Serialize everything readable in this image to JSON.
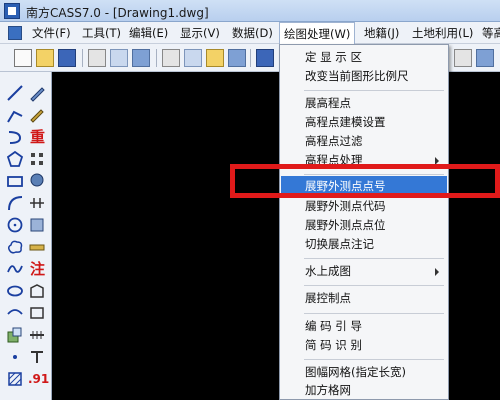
{
  "window": {
    "title": "南方CASS7.0 - [Drawing1.dwg]"
  },
  "menubar": {
    "items": [
      {
        "label": "文件(F)"
      },
      {
        "label": "工具(T)"
      },
      {
        "label": "编辑(E)"
      },
      {
        "label": "显示(V)"
      },
      {
        "label": "数据(D)"
      },
      {
        "label": "绘图处理(W)",
        "active": true
      },
      {
        "label": "地籍(J)"
      },
      {
        "label": "土地利用(L)"
      },
      {
        "label": "等高"
      }
    ]
  },
  "dropdown": {
    "items": [
      {
        "label": "定 显 示 区"
      },
      {
        "label": "改变当前图形比例尺"
      },
      {
        "label": "展高程点"
      },
      {
        "label": "高程点建模设置"
      },
      {
        "label": "高程点过滤"
      },
      {
        "label": "高程点处理",
        "submenu": true
      },
      {
        "label": "展野外测点点号",
        "highlighted": true
      },
      {
        "label": "展野外测点代码"
      },
      {
        "label": "展野外测点点位"
      },
      {
        "label": "切换展点注记"
      },
      {
        "label": "水上成图",
        "submenu": true
      },
      {
        "label": "展控制点"
      },
      {
        "label": "编 码 引 导"
      },
      {
        "label": "简 码 识 别"
      },
      {
        "label": "图幅网格(指定长宽)"
      },
      {
        "label": "加方格网"
      }
    ]
  },
  "toolbox": {
    "glyphs": [
      {
        "text": "重",
        "color": "#d01818"
      },
      {
        "text": "注",
        "color": "#d01818"
      },
      {
        "text": ".91",
        "color": "#d01818"
      }
    ]
  },
  "colors": {
    "canvas": "#000000",
    "highlight": "#3478d6",
    "annotation": "#e01a1a"
  },
  "icons": [
    "app-icon",
    "new-file-icon",
    "open-folder-icon",
    "save-icon",
    "print-icon",
    "preview-icon",
    "cut-icon",
    "copy-icon",
    "paste-icon",
    "brush-icon",
    "undo-icon",
    "line-icon",
    "polyline-icon",
    "circle-icon",
    "rectangle-icon",
    "pentagon-icon",
    "arc-icon"
  ]
}
